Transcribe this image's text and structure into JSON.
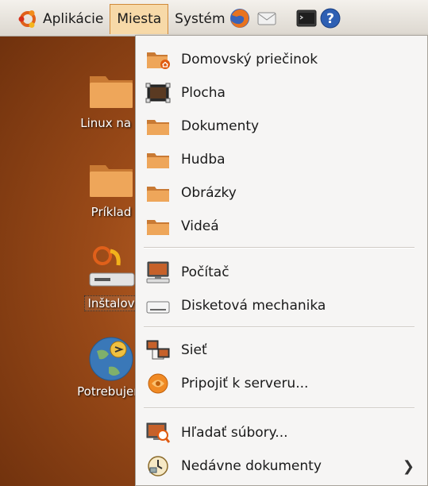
{
  "panel": {
    "menus": [
      "Aplikácie",
      "Miesta",
      "Systém"
    ],
    "active_menu": "Miesta"
  },
  "desktop": {
    "icons": [
      {
        "label": "Linux na v",
        "icon": "folder-icon"
      },
      {
        "label": "Príklad",
        "icon": "folder-icon"
      },
      {
        "label": "Inštalov",
        "icon": "installer-icon"
      },
      {
        "label": "Potrebujem",
        "icon": "help-globe-icon"
      }
    ]
  },
  "places_menu": {
    "items": [
      {
        "label": "Domovský priečinok",
        "icon": "home-folder-icon"
      },
      {
        "label": "Plocha",
        "icon": "desktop-icon"
      },
      {
        "label": "Dokumenty",
        "icon": "folder-icon"
      },
      {
        "label": "Hudba",
        "icon": "folder-icon"
      },
      {
        "label": "Obrázky",
        "icon": "folder-icon"
      },
      {
        "label": "Videá",
        "icon": "folder-icon"
      },
      {
        "label": "Počítač",
        "icon": "computer-icon"
      },
      {
        "label": "Disketová mechanika",
        "icon": "floppy-drive-icon"
      },
      {
        "label": "Sieť",
        "icon": "network-icon"
      },
      {
        "label": "Pripojiť k serveru...",
        "icon": "connect-server-icon"
      },
      {
        "label": "Hľadať súbory...",
        "icon": "search-files-icon"
      },
      {
        "label": "Nedávne dokumenty",
        "icon": "recent-documents-icon",
        "submenu": true
      }
    ]
  },
  "colors": {
    "desktop_bg": "#9a4a18",
    "menu_bg": "#f6f5f4",
    "active_menu_bg": "#f7d9a8",
    "folder": "#e8a050"
  }
}
